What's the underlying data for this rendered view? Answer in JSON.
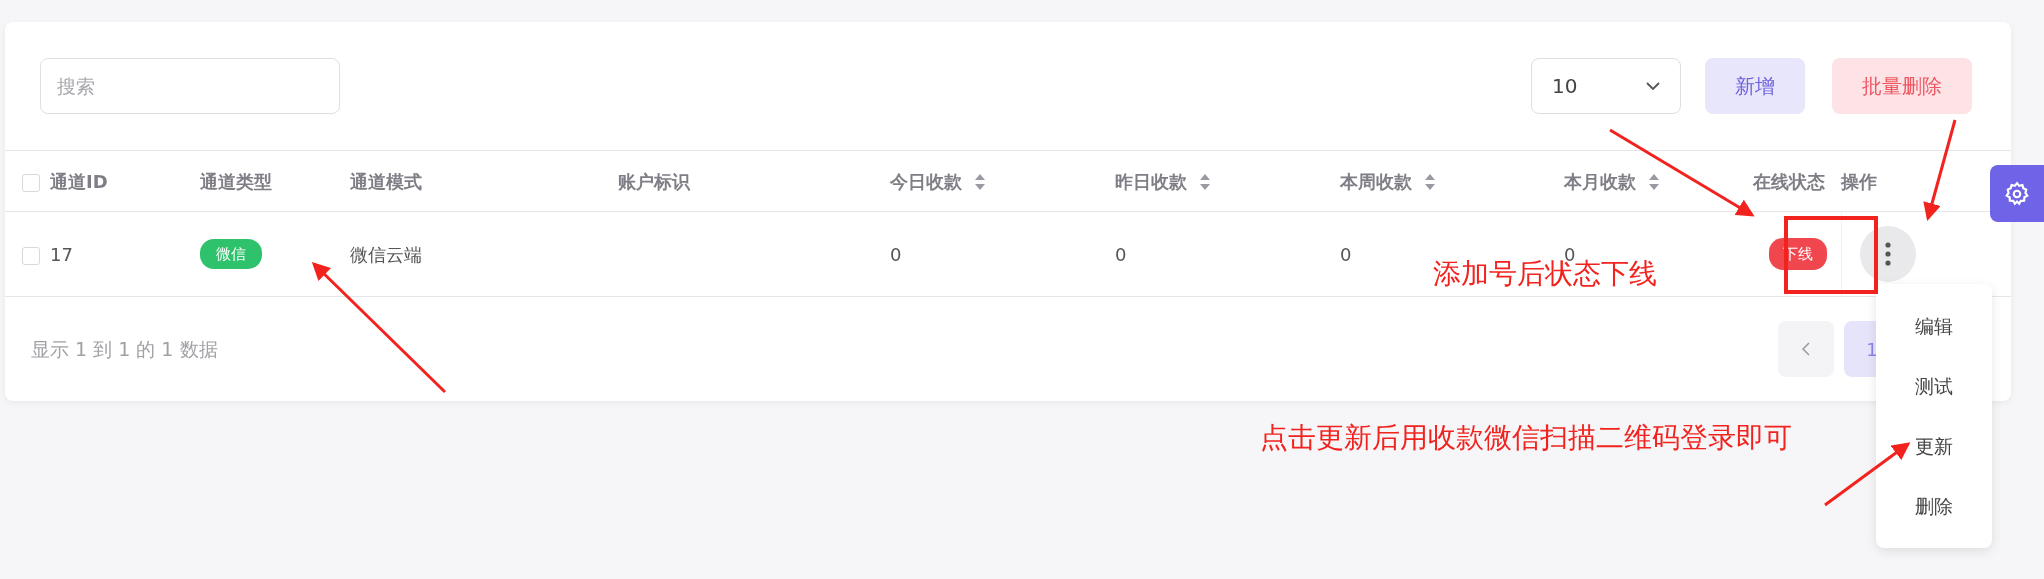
{
  "toolbar": {
    "search": {
      "placeholder": "搜索"
    },
    "page_size": "10",
    "buttons": [
      {
        "label": "新增",
        "kind": "add"
      },
      {
        "label": "批量删除",
        "kind": "delete"
      }
    ]
  },
  "table": {
    "select_all": {
      "checked": false
    },
    "columns": [
      {
        "label": "通道ID",
        "sortable": false
      },
      {
        "label": "通道类型",
        "sortable": false
      },
      {
        "label": "通道模式",
        "sortable": false
      },
      {
        "label": "账户标识",
        "sortable": false
      },
      {
        "label": "今日收款",
        "sortable": true
      },
      {
        "label": "昨日收款",
        "sortable": true
      },
      {
        "label": "本周收款",
        "sortable": true
      },
      {
        "label": "本月收款",
        "sortable": true
      },
      {
        "label": "在线状态",
        "sortable": false
      },
      {
        "label": "操作",
        "sortable": false
      }
    ],
    "rows": [
      {
        "checked": false,
        "id": "17",
        "type": {
          "label": "微信",
          "color": "#2ec26c"
        },
        "mode": "微信云端",
        "today": "0",
        "yesterday": "0",
        "week": "0",
        "month": "0",
        "status": {
          "label": "下线",
          "online": false
        }
      }
    ]
  },
  "action_menu": {
    "items": [
      "编辑",
      "测试",
      "更新",
      "删除"
    ]
  },
  "footer": {
    "summary": "显示 1 到 1 的 1 数据",
    "pagination": [
      {
        "kind": "prev",
        "selected": false
      },
      {
        "kind": "page",
        "label": "1",
        "selected": true
      }
    ]
  },
  "annotations": [
    {
      "text": "添加号后状态下线"
    },
    {
      "text": "点击更新后用收款微信扫描二维码登录即可"
    }
  ]
}
